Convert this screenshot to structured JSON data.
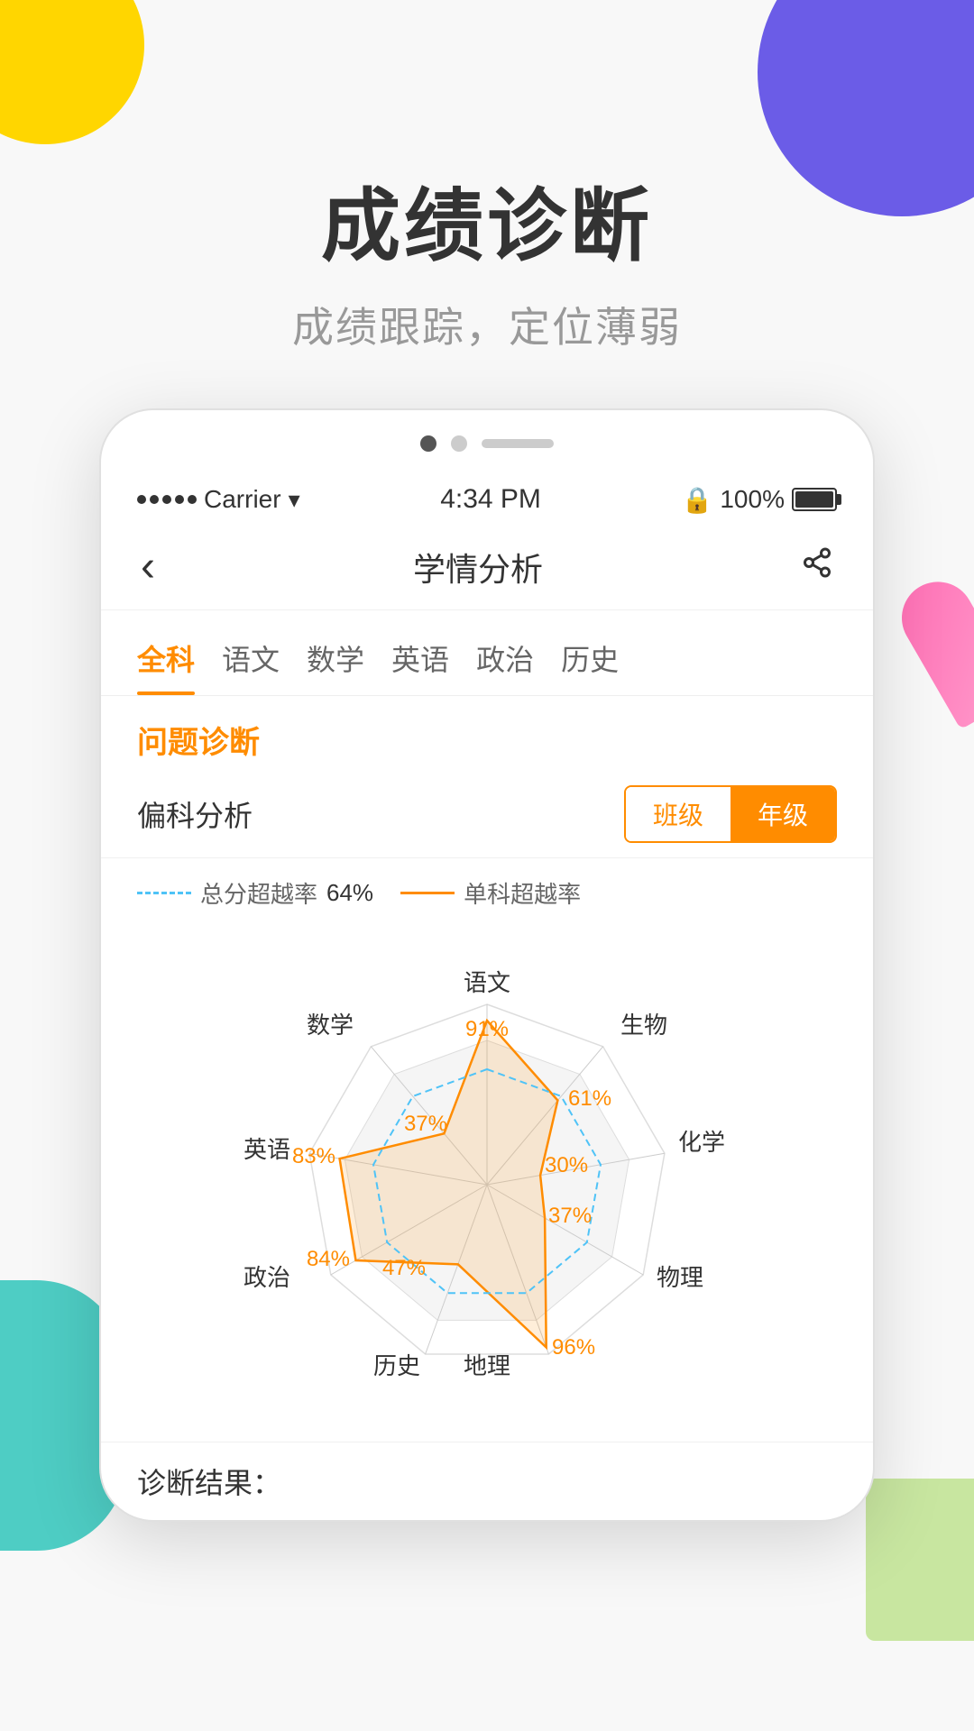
{
  "page": {
    "background": {
      "deco_yellow": "decorative yellow circle top-left",
      "deco_purple": "decorative purple circle top-right",
      "deco_teal": "decorative teal shape bottom-left",
      "deco_green": "decorative green shape bottom-right",
      "deco_pencil": "decorative pencil shape right"
    },
    "header": {
      "main_title": "成绩诊断",
      "subtitle": "成绩跟踪，定位薄弱"
    },
    "pagination": {
      "dots": [
        "active",
        "inactive",
        "line"
      ]
    },
    "status_bar": {
      "carrier": "Carrier",
      "time": "4:34 PM",
      "battery_pct": "100%"
    },
    "nav": {
      "back_icon": "‹",
      "title": "学情分析",
      "share_icon": "share"
    },
    "tabs": [
      {
        "label": "全科",
        "active": true
      },
      {
        "label": "语文",
        "active": false
      },
      {
        "label": "数学",
        "active": false
      },
      {
        "label": "英语",
        "active": false
      },
      {
        "label": "政治",
        "active": false
      },
      {
        "label": "历史",
        "active": false
      }
    ],
    "section": {
      "title": "问题诊断"
    },
    "analysis": {
      "label": "偏科分析",
      "toggle": {
        "class_label": "班级",
        "grade_label": "年级",
        "active": "grade"
      },
      "legend": {
        "total_label": "总分超越率",
        "total_pct": "64%",
        "single_label": "单科超越率"
      }
    },
    "radar": {
      "subjects": [
        {
          "name": "语文",
          "pct": "91%",
          "position": "top"
        },
        {
          "name": "生物",
          "pct": "61%",
          "position": "top-right"
        },
        {
          "name": "化学",
          "pct": "30%",
          "position": "right"
        },
        {
          "name": "物理",
          "pct": "37%",
          "position": "bottom-right"
        },
        {
          "name": "地理",
          "pct": "96%",
          "position": "bottom"
        },
        {
          "name": "历史",
          "pct": "47%",
          "position": "bottom-left"
        },
        {
          "name": "政治",
          "pct": "84%",
          "position": "left"
        },
        {
          "name": "英语",
          "pct": "83%",
          "position": "left"
        },
        {
          "name": "数学",
          "pct": "37%",
          "position": "top-left"
        }
      ]
    },
    "result": {
      "label": "诊断结果："
    }
  }
}
